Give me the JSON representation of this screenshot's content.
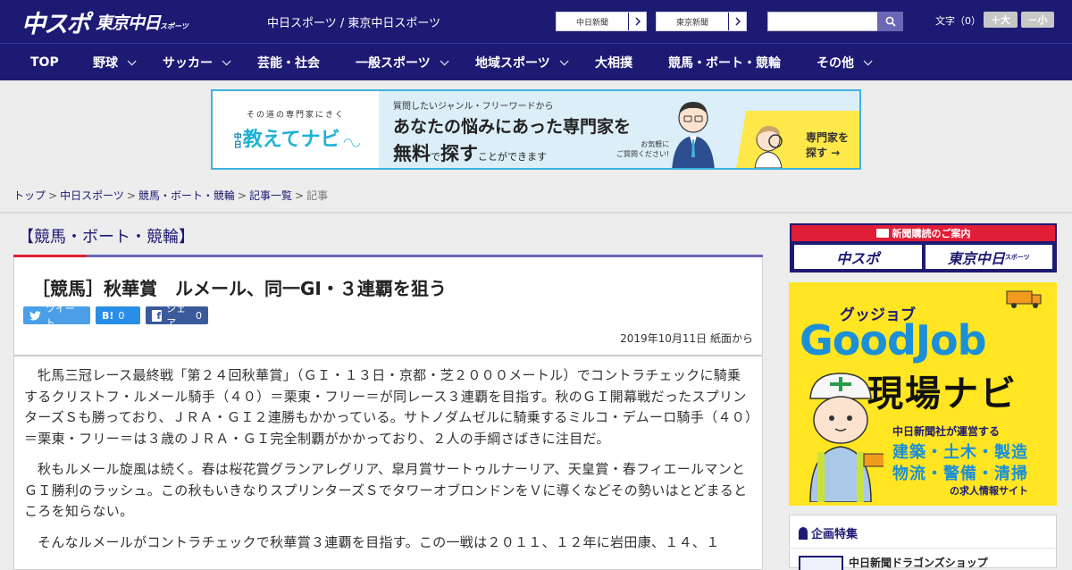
{
  "header": {
    "logo_main": "中スポ",
    "logo_sub": "東京中日",
    "logo_sub_small": "スポーツ",
    "site_links": "中日スポーツ / 東京中日スポーツ",
    "paper_buttons": [
      "中日新聞",
      "東京新聞"
    ],
    "search_placeholder": "",
    "font_size_label": "文字（0）",
    "font_larger": "＋大",
    "font_smaller": "－小"
  },
  "nav": {
    "items": [
      {
        "label": "TOP",
        "dropdown": false
      },
      {
        "label": "野球",
        "dropdown": true
      },
      {
        "label": "サッカー",
        "dropdown": true
      },
      {
        "label": "芸能・社会",
        "dropdown": false
      },
      {
        "label": "一般スポーツ",
        "dropdown": true
      },
      {
        "label": "地域スポーツ",
        "dropdown": true
      },
      {
        "label": "大相撲",
        "dropdown": false
      },
      {
        "label": "競馬・ボート・競輪",
        "dropdown": false
      },
      {
        "label": "その他",
        "dropdown": true
      }
    ]
  },
  "banner": {
    "tag": "その道の専門家にきく",
    "brand": "教えてナビ",
    "brand_mini": "中日",
    "question": "質問したいジャンル・フリーワードから",
    "line1": "あなたの悩みにあった専門家を",
    "line2_a": "無料",
    "line2_b": "で",
    "line2_c": "探す",
    "line2_d": "ことができます",
    "note_1": "お気軽に",
    "note_2": "ご質問ください!",
    "cta_1": "専門家を",
    "cta_2": "探す →"
  },
  "breadcrumb": {
    "items": [
      "トップ",
      "中日スポーツ",
      "競馬・ボート・競輪",
      "記事一覧"
    ],
    "separator": ">",
    "current": "記事"
  },
  "section": {
    "title": "【競馬・ボート・競輪】"
  },
  "article": {
    "title": "［競馬］秋華賞　ルメール、同一GI・３連覇を狙う",
    "share": {
      "tweet_label": "ツイート",
      "hatena_label": "B!",
      "hatena_count": "0",
      "fb_label": "シェア",
      "fb_count": "0"
    },
    "date": "2019年10月11日 紙面から",
    "paragraphs": [
      "牝馬三冠レース最終戦「第２４回秋華賞」（ＧＩ・１３日・京都・芝２０００メートル）でコントラチェックに騎乗するクリストフ・ルメール騎手（４０）＝栗東・フリー＝が同レース３連覇を目指す。秋のＧＩ開幕戦だったスプリンターズＳも勝っており、ＪＲＡ・ＧＩ２連勝もかかっている。サトノダムゼルに騎乗するミルコ・デムーロ騎手（４０）＝栗東・フリー＝は３歳のＪＲＡ・ＧＩ完全制覇がかかっており、２人の手綱さばきに注目だ。",
      "秋もルメール旋風は続く。春は桜花賞グランアレグリア、皐月賞サートゥルナーリア、天皇賞・春フィエールマンとＧＩ勝利のラッシュ。この秋もいきなりスプリンターズＳでタワーオブロンドンをＶに導くなどその勢いはとどまるところを知らない。",
      "そんなルメールがコントラチェックで秋華賞３連覇を目指す。この一戦は２０１１、１２年に岩田康、１４、１"
    ]
  },
  "sidebar": {
    "subscribe_head": "新聞購読のご案内",
    "subscribe_logo_1": "中スポ",
    "subscribe_logo_2": "東京中日",
    "subscribe_logo_2_small": "スポーツ",
    "goodjob": {
      "top": "グッジョブ",
      "logo": "GoodJob",
      "navi": "現場ナビ",
      "sub": "中日新聞社が運営する",
      "line1": "建築・土木・製造",
      "line2": "物流・警備・清掃",
      "foot": "の求人情報サイト"
    },
    "feature_title": "企画特集",
    "feature_item": "中日新聞ドラゴンズショップ"
  },
  "colors": {
    "brand_navy": "#1d1a73",
    "accent_red": "#e01e37",
    "twitter": "#4a9fe8",
    "hatena": "#2a8de6",
    "facebook": "#3a5a9c",
    "goodjob_yellow": "#ffe522"
  }
}
